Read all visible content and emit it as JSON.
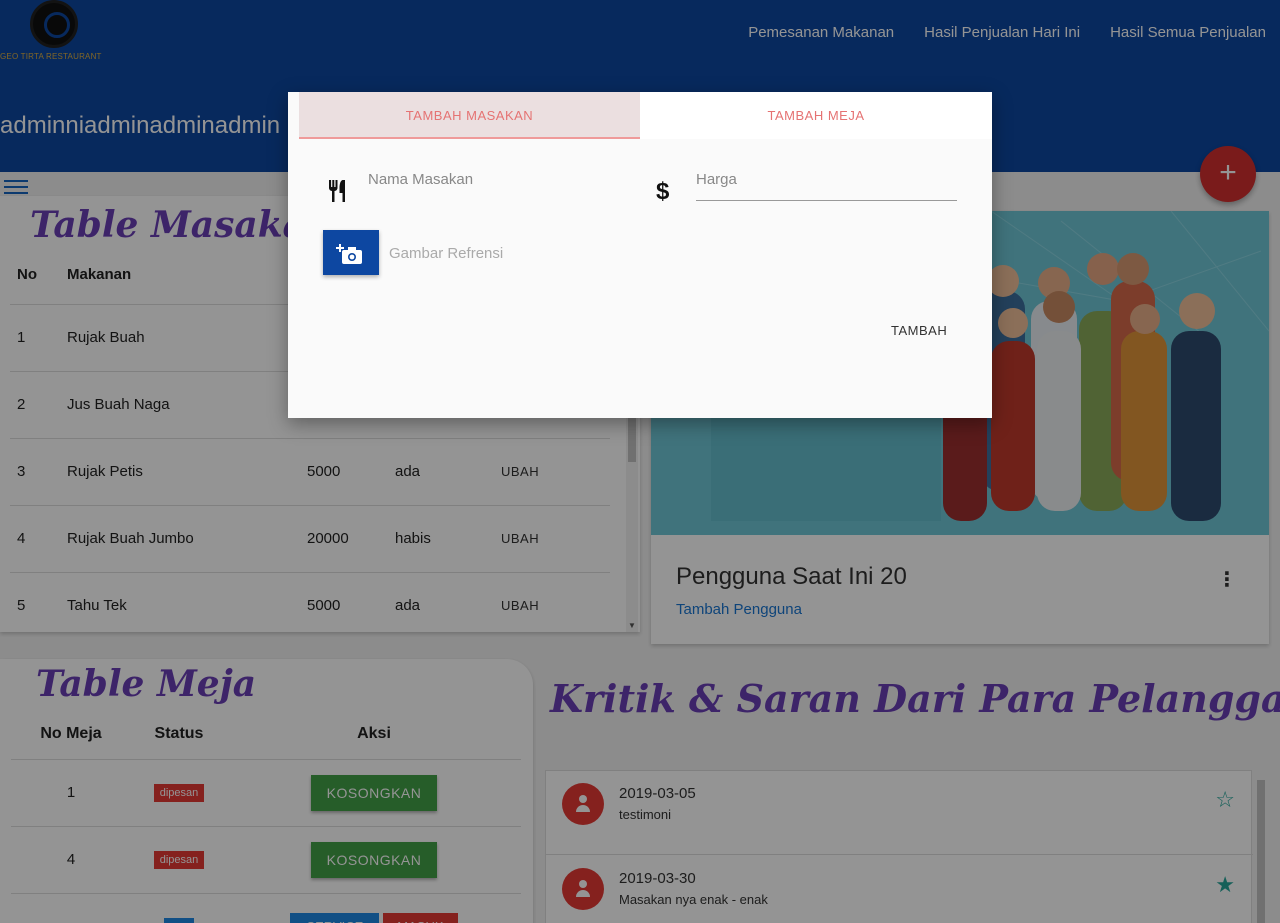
{
  "header": {
    "logo_text": "GEO TIRTA RESTAURANT",
    "nav": [
      "Pemesanan Makanan",
      "Hasil Penjualan Hari Ini",
      "Hasil Semua Penjualan"
    ],
    "username": "adminniadminadminadmin"
  },
  "masakan": {
    "title": "Table Masakan",
    "headers": [
      "No",
      "Makanan",
      "",
      "",
      ""
    ],
    "rows": [
      {
        "no": "1",
        "name": "Rujak Buah",
        "price": "",
        "status": "",
        "action": ""
      },
      {
        "no": "2",
        "name": "Jus Buah Naga",
        "price": "",
        "status": "",
        "action": ""
      },
      {
        "no": "3",
        "name": "Rujak Petis",
        "price": "5000",
        "status": "ada",
        "action": "UBAH"
      },
      {
        "no": "4",
        "name": "Rujak Buah Jumbo",
        "price": "20000",
        "status": "habis",
        "action": "UBAH"
      },
      {
        "no": "5",
        "name": "Tahu Tek",
        "price": "5000",
        "status": "ada",
        "action": "UBAH"
      }
    ]
  },
  "users_card": {
    "title": "Pengguna Saat Ini 20",
    "link": "Tambah Pengguna"
  },
  "meja": {
    "title": "Table Meja",
    "headers": [
      "No Meja",
      "Status",
      "Aksi"
    ],
    "rows": [
      {
        "no": "1",
        "status": "dipesan",
        "action": "KOSONGKAN"
      },
      {
        "no": "4",
        "status": "dipesan",
        "action": "KOSONGKAN"
      }
    ],
    "partial_actions": [
      "SERVICE",
      "MASUK"
    ]
  },
  "kritik": {
    "title": "Kritik & Saran Dari Para Pelanggan",
    "items": [
      {
        "date": "2019-03-05",
        "text": "testimoni",
        "star": "☆"
      },
      {
        "date": "2019-03-30",
        "text": "Masakan nya enak - enak",
        "star": "★"
      }
    ]
  },
  "modal": {
    "tabs": [
      "TAMBAH MASAKAN",
      "TAMBAH MEJA"
    ],
    "nama_placeholder": "Nama Masakan",
    "harga_label": "Harga",
    "gambar_label": "Gambar Refrensi",
    "submit": "TAMBAH"
  },
  "icons": {
    "fab": "plus-icon",
    "menu": "hamburger-icon",
    "camera": "add-photo-icon",
    "fork": "restaurant-icon",
    "dollar": "dollar-icon"
  },
  "colors": {
    "primary": "#0d47a1",
    "fab": "#d32f2f",
    "tab_text": "#e57373",
    "badge": "#e53935",
    "green": "#43a047",
    "teal_star": "#26a69a"
  }
}
